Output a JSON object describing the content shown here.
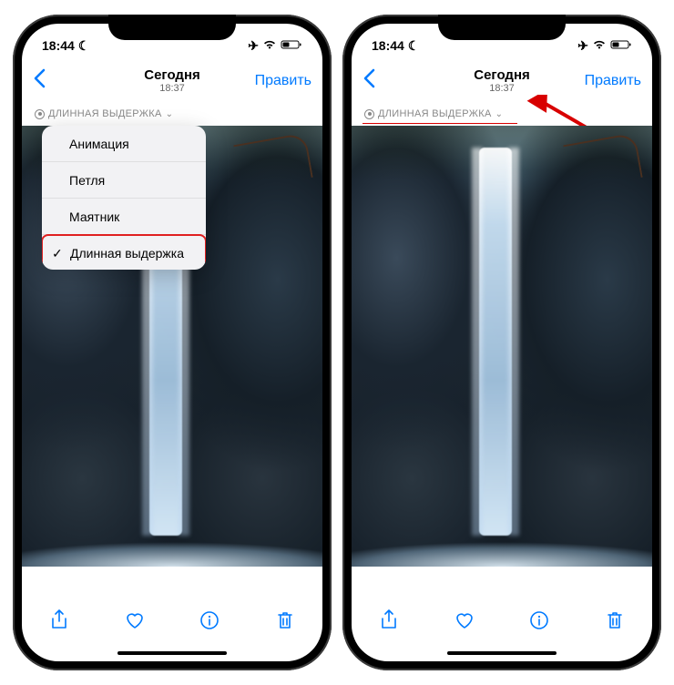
{
  "status": {
    "time": "18:44",
    "moon": "☾",
    "airplane": "✈",
    "wifi": "wifi-icon",
    "battery": "battery-icon"
  },
  "nav": {
    "title": "Сегодня",
    "subtitle": "18:37",
    "edit": "Править"
  },
  "effect": {
    "label": "ДЛИННАЯ ВЫДЕРЖКА"
  },
  "dropdown": {
    "items": [
      {
        "label": "Анимация",
        "checked": false
      },
      {
        "label": "Петля",
        "checked": false
      },
      {
        "label": "Маятник",
        "checked": false
      },
      {
        "label": "Длинная выдержка",
        "checked": true
      }
    ]
  },
  "toolbar": {
    "share": "share-icon",
    "heart": "heart-icon",
    "info": "info-icon",
    "trash": "trash-icon"
  },
  "colors": {
    "accent": "#007aff",
    "annotation": "#e02020"
  }
}
